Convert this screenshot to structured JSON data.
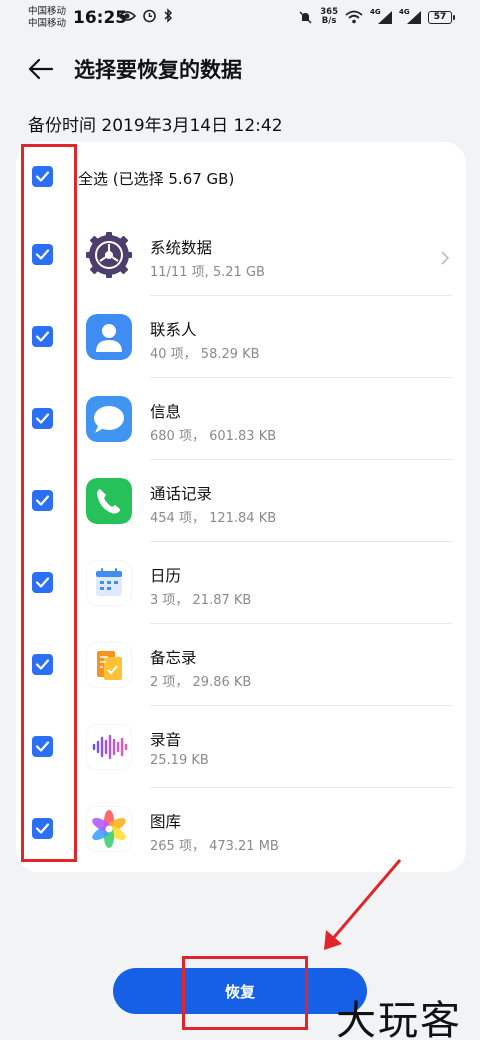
{
  "status_bar": {
    "carrier1": "中国移动",
    "carrier2": "中国移动",
    "time": "16:25",
    "speed_value": "365",
    "speed_unit": "B/s",
    "net1": "4G",
    "net2": "4G",
    "battery": "57"
  },
  "header": {
    "title": "选择要恢复的数据",
    "backup_time": "备份时间 2019年3月14日 12:42"
  },
  "select_all": {
    "label": "全选 (已选择 5.67 GB)",
    "checked": true
  },
  "items": [
    {
      "name": "系统数据",
      "meta": "11/11 项, 5.21 GB",
      "icon": "system-settings-icon",
      "checked": true,
      "has_chevron": true
    },
    {
      "name": "联系人",
      "meta": "40 项， 58.29 KB",
      "icon": "contacts-icon",
      "checked": true
    },
    {
      "name": "信息",
      "meta": "680 项， 601.83 KB",
      "icon": "messages-icon",
      "checked": true
    },
    {
      "name": "通话记录",
      "meta": "454 项， 121.84 KB",
      "icon": "phone-icon",
      "checked": true
    },
    {
      "name": "日历",
      "meta": "3 项， 21.87 KB",
      "icon": "calendar-icon",
      "checked": true
    },
    {
      "name": "备忘录",
      "meta": "2 项， 29.86 KB",
      "icon": "notes-icon",
      "checked": true
    },
    {
      "name": "录音",
      "meta": "25.19 KB",
      "icon": "recorder-icon",
      "checked": true
    },
    {
      "name": "图库",
      "meta": "265 项， 473.21 MB",
      "icon": "gallery-icon",
      "checked": true
    }
  ],
  "restore_button": {
    "label": "恢复"
  },
  "watermark": "大玩客",
  "colors": {
    "accent": "#2a6ff5",
    "button": "#1560e6",
    "annotation": "#e0262b",
    "background": "#f1f3f5"
  }
}
